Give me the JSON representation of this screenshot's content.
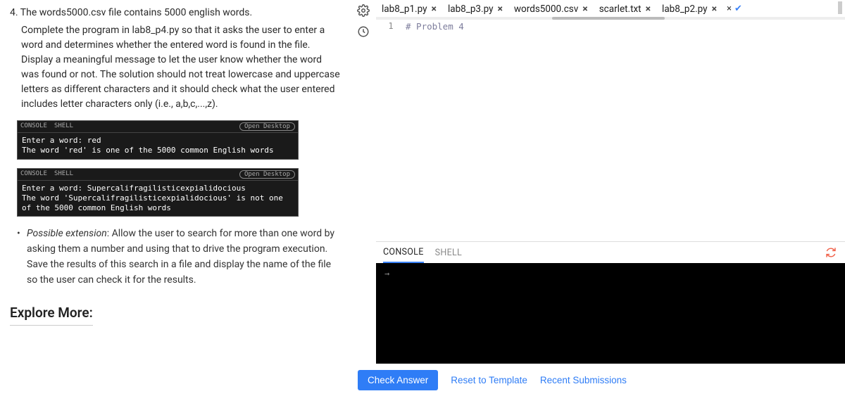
{
  "problem": {
    "number": "4.",
    "first_line": "The words5000.csv file contains 5000 english words.",
    "body": "Complete the program in lab8_p4.py so that it asks the user to enter a word and determines whether the entered word is found in the file. Display a meaningful message to let the user know whether the word was found or not. The solution should not treat lowercase and uppercase letters as different characters and it should check what the user entered includes letter characters only (i.e., a,b,c,...,z)."
  },
  "term1": {
    "open_desktop": "Open Desktop",
    "body": "Enter a word: red\nThe word 'red' is one of the 5000 common English words"
  },
  "term2": {
    "tab_console": "CONSOLE",
    "tab_shell": "SHELL",
    "open_desktop": "Open Desktop",
    "body": "Enter a word: Supercalifragilisticexpialidocious\nThe word 'Supercalifragilisticexpialidocious' is not one of the 5000 common English words"
  },
  "extension": {
    "label": "Possible extension",
    "text": ": Allow the user to search for more than one word by asking them a number and using that to drive the program execution. Save the results of this search in a file and display the name of the file so the user can check it for the results."
  },
  "explore": "Explore More:",
  "tabs": [
    {
      "label": "lab8_p1.py"
    },
    {
      "label": "lab8_p3.py"
    },
    {
      "label": "words5000.csv"
    },
    {
      "label": "scarlet.txt"
    },
    {
      "label": "lab8_p2.py"
    }
  ],
  "tab_close_glyph": "×",
  "editor": {
    "line_num": "1",
    "code": "# Problem 4"
  },
  "console": {
    "tab_console": "CONSOLE",
    "tab_shell": "SHELL",
    "prompt": "→"
  },
  "actions": {
    "check": "Check Answer",
    "reset": "Reset to Template",
    "recent": "Recent Submissions"
  }
}
